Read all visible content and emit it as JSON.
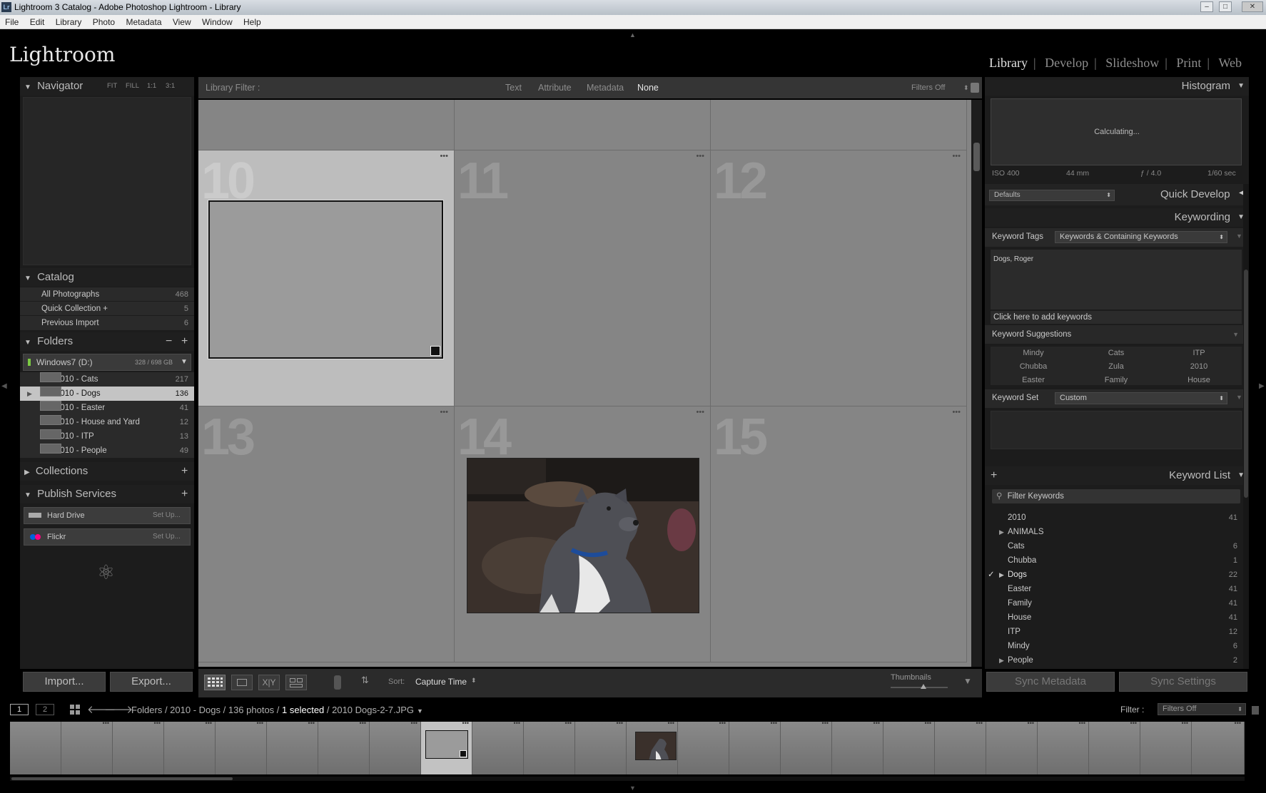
{
  "window": {
    "title": "Lightroom 3 Catalog - Adobe Photoshop Lightroom - Library",
    "app_icon": "Lr"
  },
  "menu": [
    "File",
    "Edit",
    "Library",
    "Photo",
    "Metadata",
    "View",
    "Window",
    "Help"
  ],
  "identity": "Lightroom",
  "modules": [
    "Library",
    "Develop",
    "Slideshow",
    "Print",
    "Web"
  ],
  "navigator": {
    "title": "Navigator",
    "zoom": [
      "FIT",
      "FILL",
      "1:1",
      "3:1"
    ]
  },
  "catalog": {
    "title": "Catalog",
    "items": [
      {
        "label": "All Photographs",
        "count": "468"
      },
      {
        "label": "Quick Collection  +",
        "count": "5"
      },
      {
        "label": "Previous Import",
        "count": "6"
      }
    ]
  },
  "folders": {
    "title": "Folders",
    "volume": "Windows7 (D:)",
    "volume_size": "328 / 698 GB",
    "items": [
      {
        "label": "2010 - Cats",
        "count": "217"
      },
      {
        "label": "2010 - Dogs",
        "count": "136"
      },
      {
        "label": "2010 - Easter",
        "count": "41"
      },
      {
        "label": "2010 - House and Yard",
        "count": "12"
      },
      {
        "label": "2010 - ITP",
        "count": "13"
      },
      {
        "label": "2010 - People",
        "count": "49"
      }
    ]
  },
  "collections": {
    "title": "Collections"
  },
  "publish": {
    "title": "Publish Services",
    "items": [
      {
        "label": "Hard Drive",
        "action": "Set Up..."
      },
      {
        "label": "Flickr",
        "action": "Set Up..."
      }
    ]
  },
  "left_buttons": {
    "import": "Import...",
    "export": "Export..."
  },
  "filter": {
    "title": "Library Filter :",
    "tabs": [
      "Text",
      "Attribute",
      "Metadata",
      "None"
    ],
    "state": "Filters Off"
  },
  "grid": {
    "cells": [
      "10",
      "11",
      "12",
      "13",
      "14",
      "15"
    ]
  },
  "toolbar": {
    "sort_label": "Sort:",
    "sort_value": "Capture Time",
    "thumbnails": "Thumbnails"
  },
  "histogram": {
    "title": "Histogram",
    "status": "Calculating...",
    "iso": "ISO 400",
    "focal": "44 mm",
    "aperture": "ƒ / 4.0",
    "shutter": "1/60 sec"
  },
  "quick_develop": {
    "preset": "Defaults",
    "title": "Quick Develop"
  },
  "keywording": {
    "title": "Keywording",
    "tags_label": "Keyword Tags",
    "tags_value": "Keywords & Containing Keywords",
    "current": "Dogs, Roger",
    "add_placeholder": "Click here to add keywords",
    "suggestions_title": "Keyword Suggestions",
    "suggestions": [
      "Mindy",
      "Cats",
      "ITP",
      "Chubba",
      "Zula",
      "2010",
      "Easter",
      "Family",
      "House"
    ],
    "set_label": "Keyword Set",
    "set_value": "Custom"
  },
  "keyword_list": {
    "title": "Keyword List",
    "filter": "Filter Keywords",
    "items": [
      {
        "label": "2010",
        "count": "41"
      },
      {
        "label": "ANIMALS",
        "count": ""
      },
      {
        "label": "Cats",
        "count": "6"
      },
      {
        "label": "Chubba",
        "count": "1"
      },
      {
        "label": "Dogs",
        "count": "22"
      },
      {
        "label": "Easter",
        "count": "41"
      },
      {
        "label": "Family",
        "count": "41"
      },
      {
        "label": "House",
        "count": "41"
      },
      {
        "label": "ITP",
        "count": "12"
      },
      {
        "label": "Mindy",
        "count": "6"
      },
      {
        "label": "People",
        "count": "2"
      }
    ]
  },
  "sync": {
    "metadata": "Sync Metadata",
    "settings": "Sync Settings"
  },
  "filmstrip": {
    "page1": "1",
    "page2": "2",
    "path_prefix": "Folders / 2010 - Dogs / 136 photos / ",
    "selected": "1 selected",
    "file": " / 2010 Dogs-2-7.JPG",
    "filter_label": "Filter :",
    "filter_value": "Filters Off"
  }
}
